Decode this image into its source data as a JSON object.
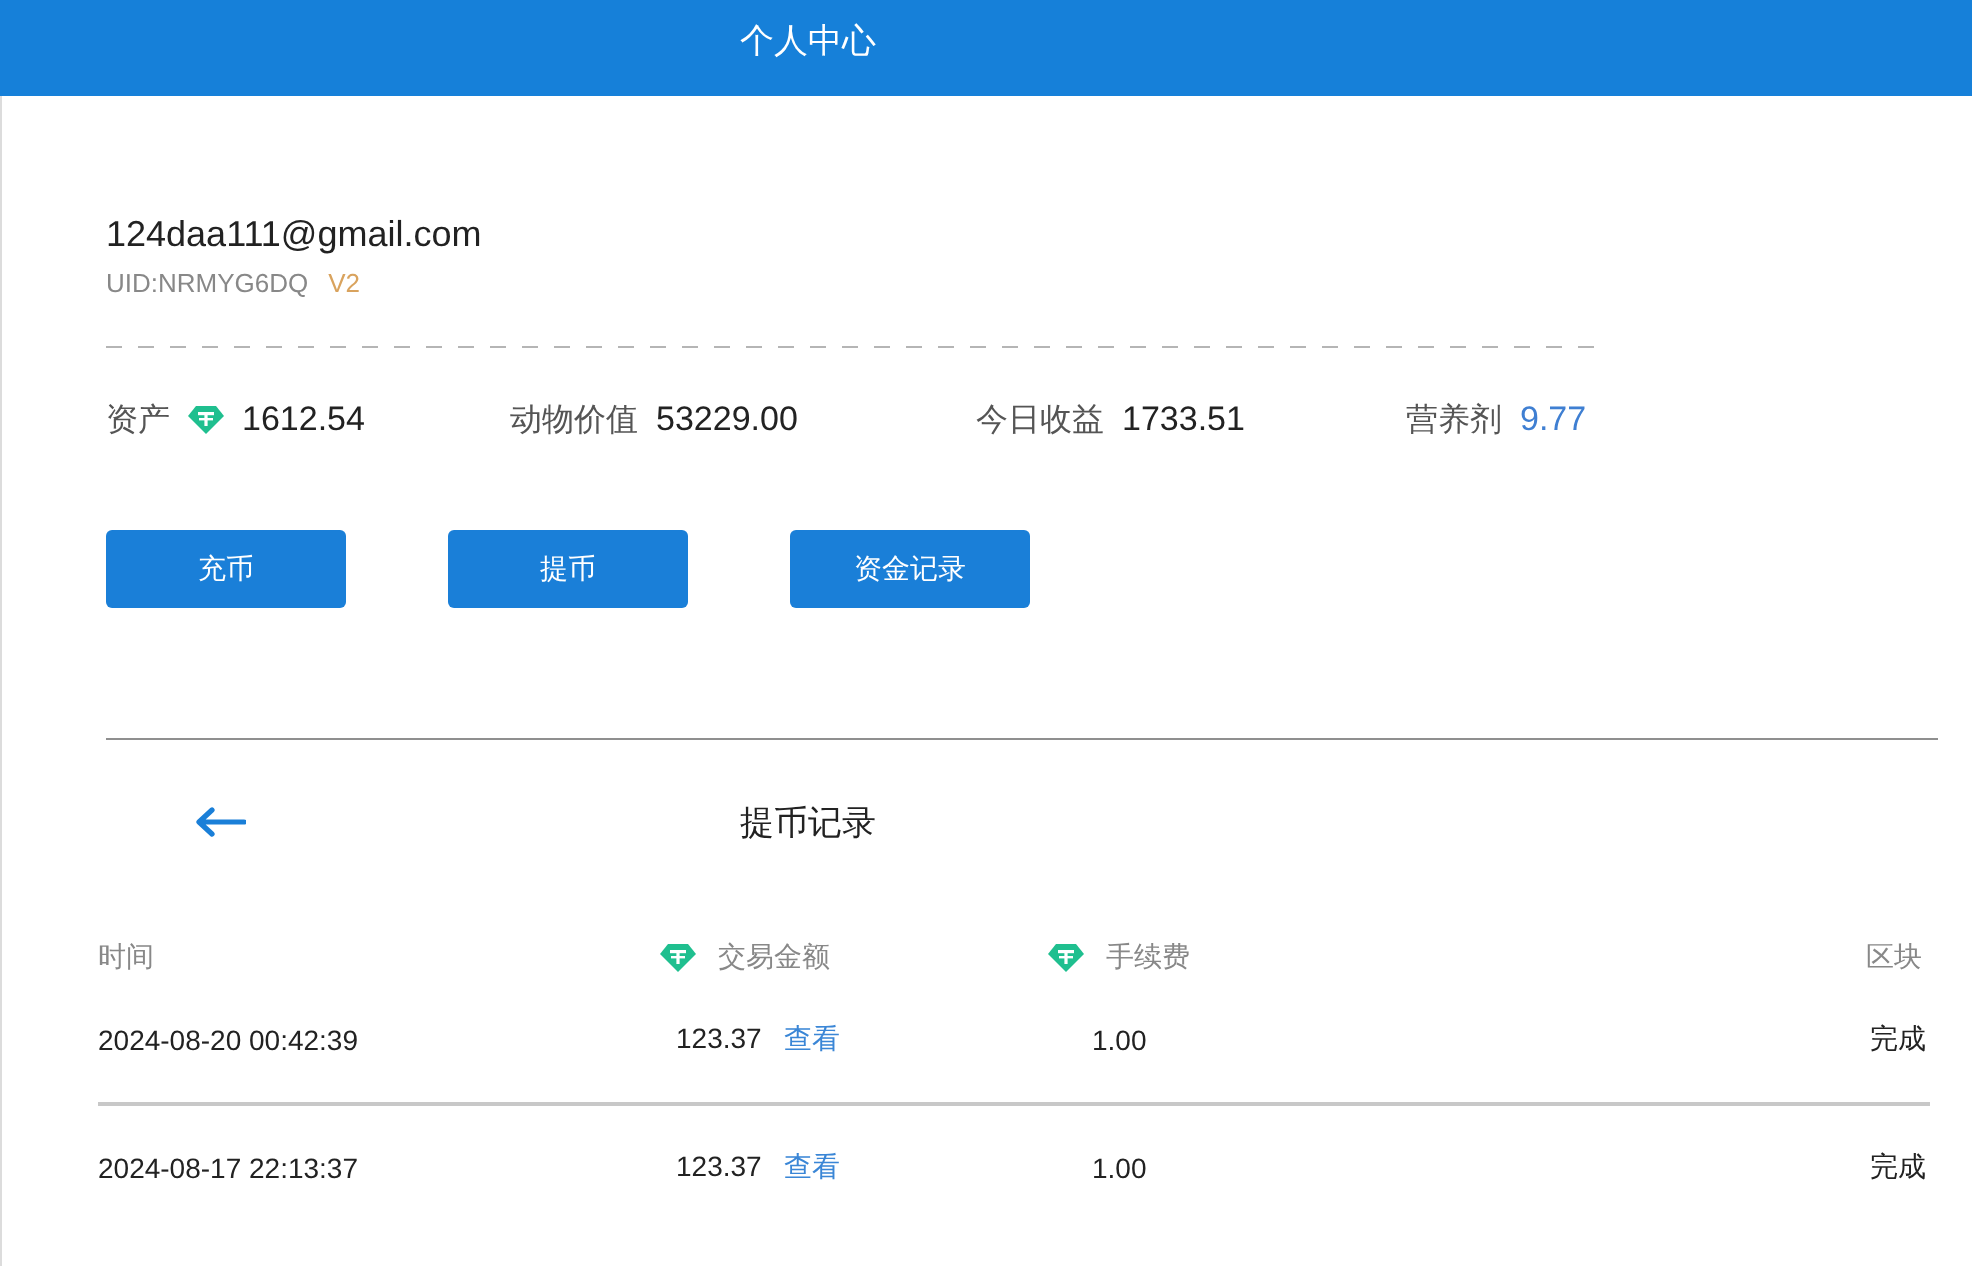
{
  "header": {
    "title": "个人中心"
  },
  "account": {
    "email": "124daa111@gmail.com",
    "uid": "UID:NRMYG6DQ",
    "level": "V2"
  },
  "stats": [
    {
      "label": "资产",
      "value": "1612.54",
      "kind": "coin"
    },
    {
      "label": "动物价值",
      "value": "53229.00",
      "kind": "plain"
    },
    {
      "label": "今日收益",
      "value": "1733.51",
      "kind": "plain"
    },
    {
      "label": "营养剂",
      "value": "9.77",
      "kind": "accent"
    }
  ],
  "buttons": [
    "充币",
    "提币",
    "资金记录"
  ],
  "records": {
    "title": "提币记录",
    "columns": [
      {
        "label": "时间",
        "kind": "plain"
      },
      {
        "label": "交易金额",
        "kind": "coin"
      },
      {
        "label": "手续费",
        "kind": "coin"
      },
      {
        "label": "区块",
        "kind": "plain"
      }
    ],
    "rows": [
      {
        "time": "2024-08-20 00:42:39",
        "amount": "123.37",
        "link": "查看",
        "fee": "1.00",
        "block": "完成"
      },
      {
        "time": "2024-08-17 22:13:37",
        "amount": "123.37",
        "link": "查看",
        "fee": "1.00",
        "block": "完成"
      }
    ]
  }
}
